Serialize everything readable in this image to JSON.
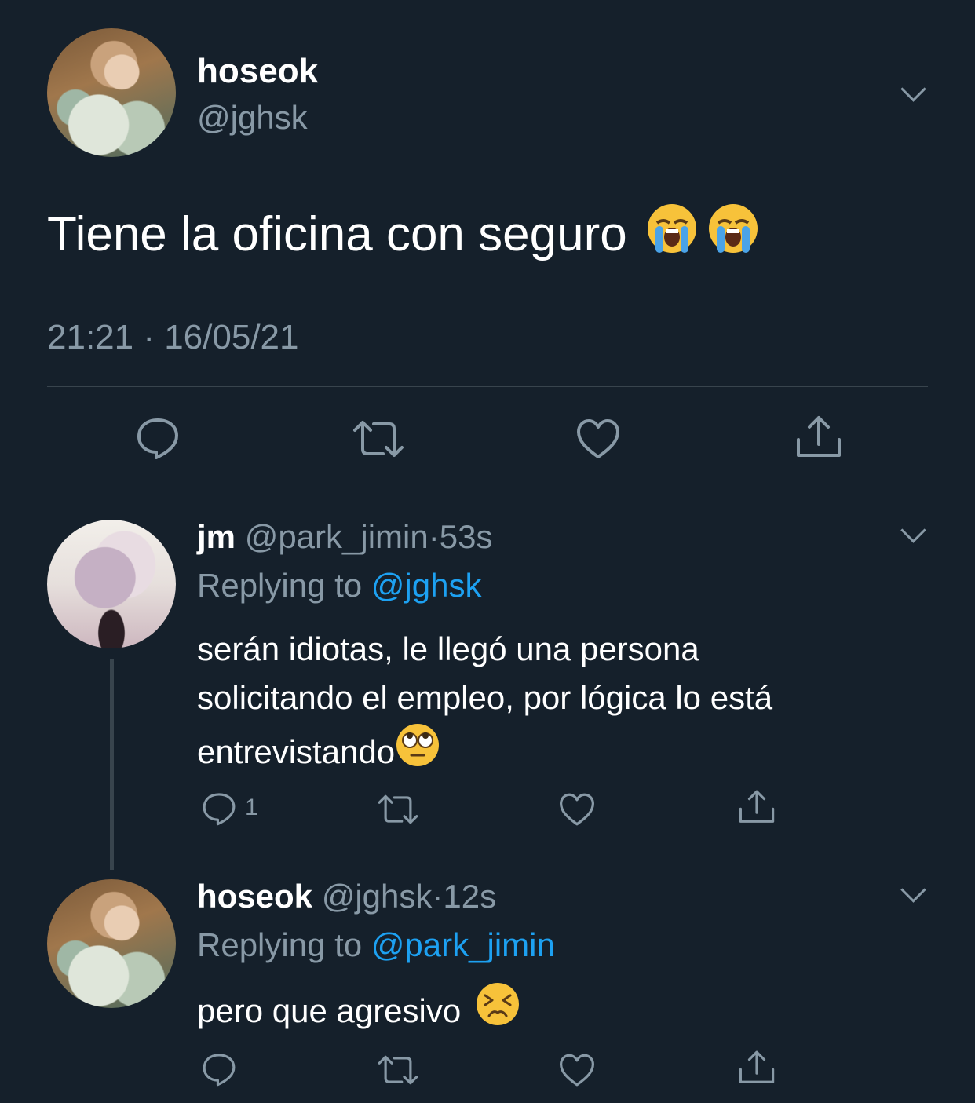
{
  "main_tweet": {
    "display_name": "hoseok",
    "handle": "@jghsk",
    "text": "Tiene la oficina con seguro",
    "emojis": "loudly-crying-face x2",
    "timestamp": "21:21 · 16/05/21"
  },
  "replies": [
    {
      "display_name": "jm",
      "handle": "@park_jimin",
      "time": "53s",
      "replying_prefix": "Replying to",
      "replying_to": "@jghsk",
      "text_line1": "serán idiotas, le llegó una persona",
      "text_line2": "solicitando el empleo, por lógica lo está",
      "text_line3": "entrevistando",
      "emoji": "face-with-rolling-eyes",
      "reply_count": "1"
    },
    {
      "display_name": "hoseok",
      "handle": "@jghsk",
      "time": "12s",
      "replying_prefix": "Replying to",
      "replying_to": "@park_jimin",
      "text": "pero que agresivo",
      "emoji": "persevering-face"
    }
  ],
  "colors": {
    "background": "#15202b",
    "muted": "#8899a6",
    "link": "#1da1f2",
    "divider": "#38444d"
  }
}
